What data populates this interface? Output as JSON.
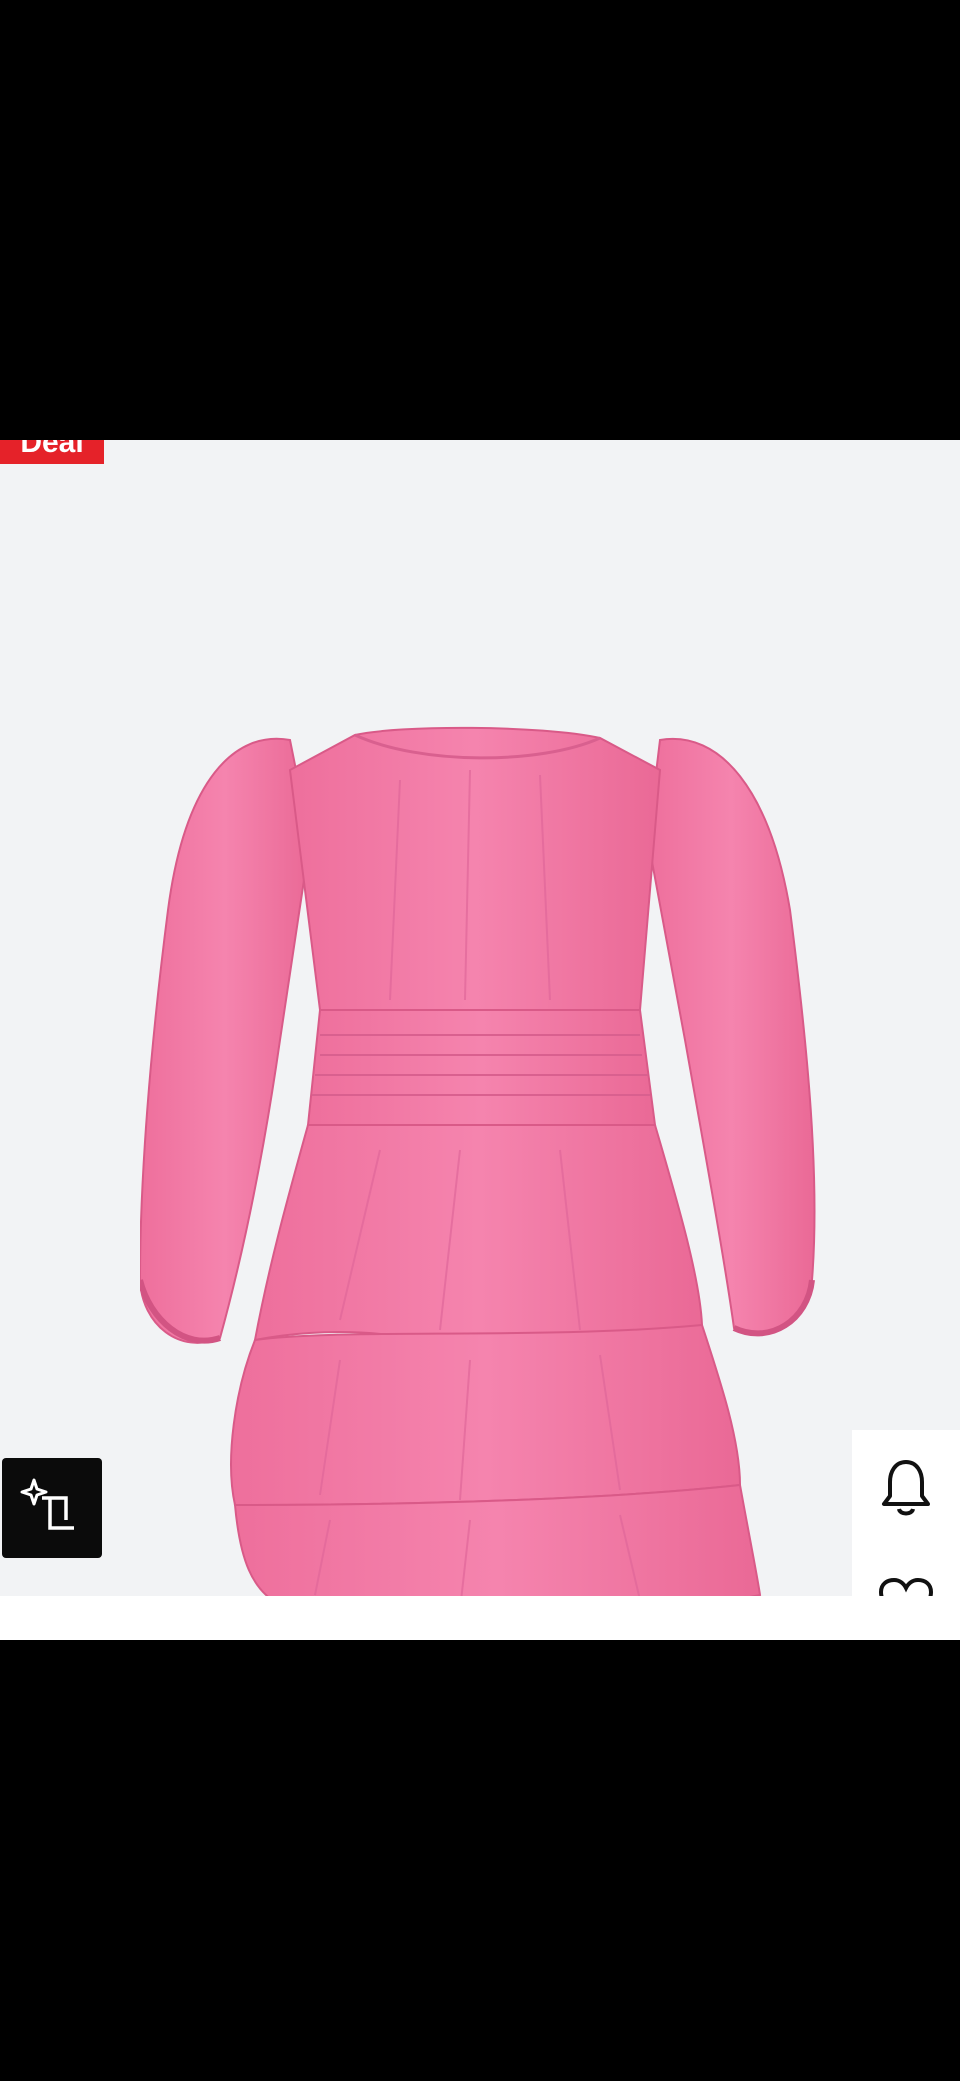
{
  "badge": {
    "label": "Deal",
    "color": "#e52229"
  },
  "product": {
    "image_icon": "pink-tiered-ruffle-dress-image",
    "color": "#f27aa5"
  },
  "actions": {
    "ai_search_icon": "sparkle-crop-icon",
    "notify_icon": "bell-icon",
    "wishlist_icon": "heart-icon"
  }
}
